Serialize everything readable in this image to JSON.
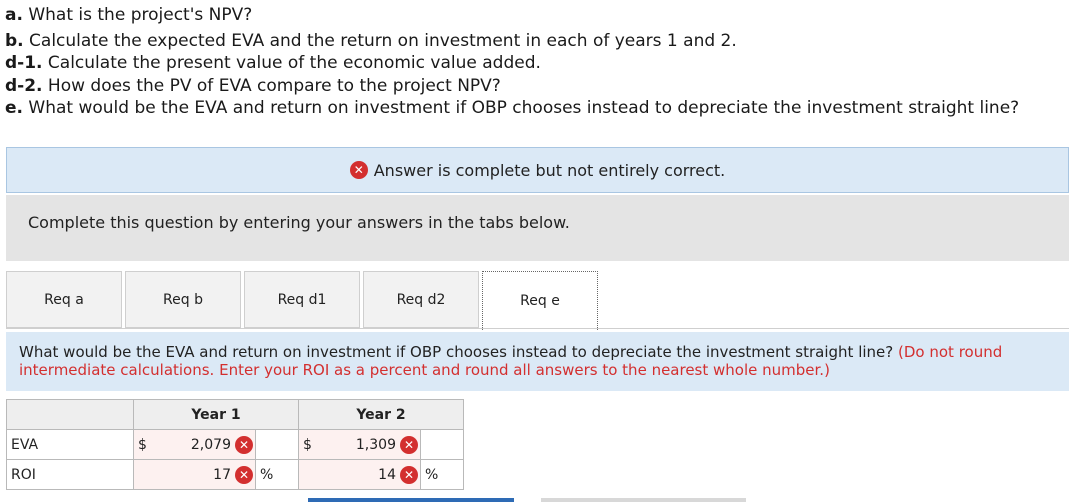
{
  "questions": [
    {
      "label": "a.",
      "text": " What is the project's NPV?"
    },
    {
      "label": "b.",
      "text": " Calculate the expected EVA and the return on investment in each of years 1 and 2."
    },
    {
      "label": "d-1.",
      "text": " Calculate the present value of the economic value added."
    },
    {
      "label": "d-2.",
      "text": " How does the PV of EVA compare to the project NPV?"
    },
    {
      "label": "e.",
      "text": " What would be the EVA and return on investment if OBP chooses instead to depreciate the investment straight line?"
    }
  ],
  "banner": {
    "icon": "x-circle-icon",
    "text": "Answer is complete but not entirely correct."
  },
  "instructions": "Complete this question by entering your answers in the tabs below.",
  "tabs": [
    {
      "label": "Req a"
    },
    {
      "label": "Req b"
    },
    {
      "label": "Req d1"
    },
    {
      "label": "Req d2"
    },
    {
      "label": "Req e",
      "active": true
    }
  ],
  "question_text": {
    "main": "What would be the EVA and return on investment if OBP chooses instead to depreciate the investment straight line?",
    "note": "(Do not round intermediate calculations. Enter your ROI as a percent and round all answers to the nearest whole number.)"
  },
  "table": {
    "headers": [
      "Year 1",
      "Year 2"
    ],
    "rows": [
      {
        "label": "EVA",
        "year1": {
          "prefix": "$",
          "value": "2,079",
          "suffix": ""
        },
        "year2": {
          "prefix": "$",
          "value": "1,309",
          "suffix": ""
        }
      },
      {
        "label": "ROI",
        "year1": {
          "prefix": "",
          "value": "17",
          "suffix": "%"
        },
        "year2": {
          "prefix": "",
          "value": "14",
          "suffix": "%"
        }
      }
    ]
  },
  "colors": {
    "error": "#d32f2f",
    "banner_bg": "#dbe9f6",
    "link_blue": "#2e6bb5"
  }
}
